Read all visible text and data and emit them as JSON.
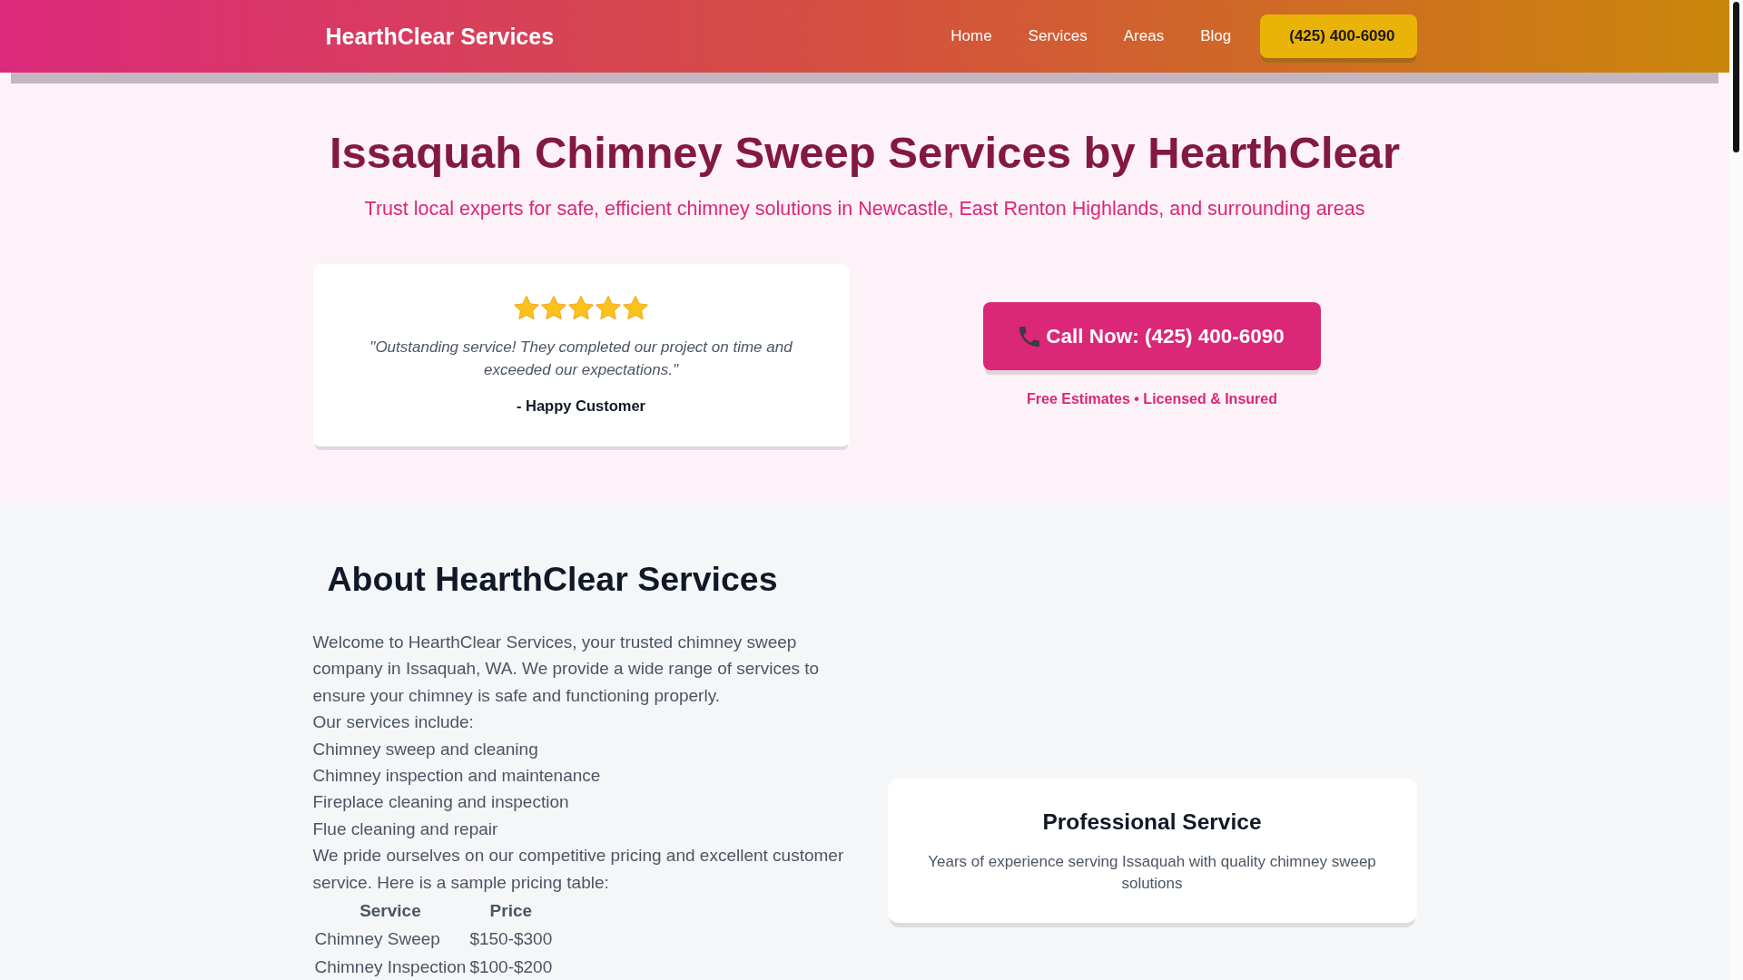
{
  "header": {
    "logo": "HearthClear Services",
    "nav": [
      "Home",
      "Services",
      "Areas",
      "Blog"
    ],
    "phone_button": "(425) 400-6090"
  },
  "hero": {
    "title": "Issaquah Chimney Sweep Services by HearthClear",
    "subtitle": "Trust local experts for safe, efficient chimney solutions in Newcastle, East Renton Highlands, and surrounding areas",
    "testimonial": {
      "stars": 5,
      "quote": "\"Outstanding service! They completed our project on time and exceeded our expectations.\"",
      "author": "- Happy Customer"
    },
    "call_button": "Call Now: (425) 400-6090",
    "note": "Free Estimates • Licensed & Insured"
  },
  "about": {
    "heading": "About HearthClear Services",
    "intro": "Welcome to HearthClear Services, your trusted chimney sweep company in Issaquah, WA. We provide a wide range of services to ensure your chimney is safe and functioning properly.",
    "services_label": "Our services include:",
    "services": [
      "Chimney sweep and cleaning",
      "Chimney inspection and maintenance",
      "Fireplace cleaning and inspection",
      "Flue cleaning and repair"
    ],
    "closing": "We pride ourselves on our competitive pricing and excellent customer service. Here is a sample pricing table:",
    "pricing_table": {
      "columns": [
        "Service",
        "Price"
      ],
      "rows": [
        [
          "Chimney Sweep",
          "$150-$300"
        ],
        [
          "Chimney Inspection",
          "$100-$200"
        ]
      ]
    }
  },
  "features": [
    {
      "title": "Professional Service",
      "description": "Years of experience serving Issaquah with quality chimney sweep solutions"
    }
  ]
}
